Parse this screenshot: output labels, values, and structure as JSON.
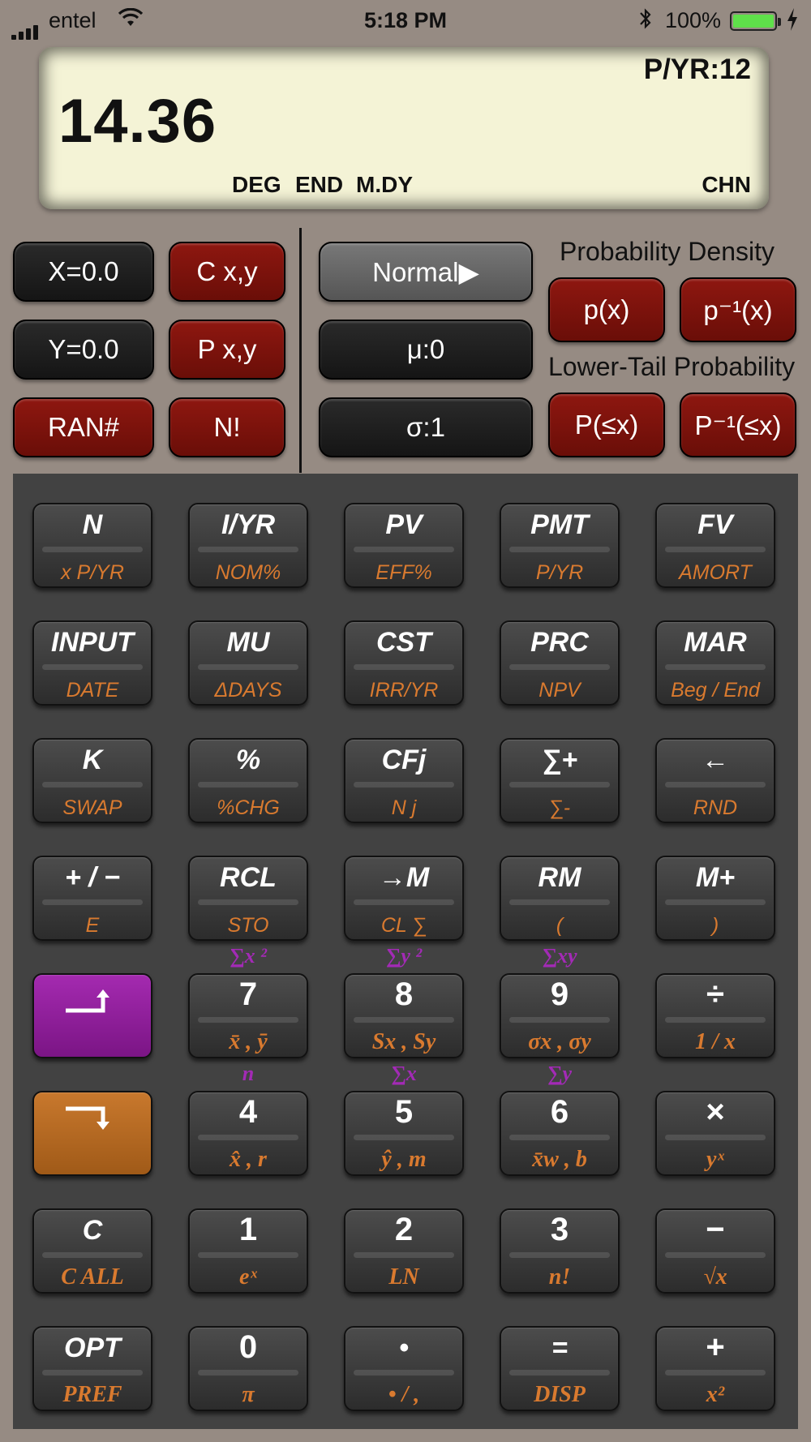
{
  "status_bar": {
    "carrier": "entel",
    "time": "5:18 PM",
    "battery_pct": "100%",
    "battery_color": "#5fe04a"
  },
  "display": {
    "pyr": "P/YR:12",
    "value": "14.36",
    "ind_deg": "DEG",
    "ind_end": "END",
    "ind_mdy": "M.DY",
    "ind_chn": "CHN"
  },
  "stats_panel": {
    "x_label": "X=0.0",
    "y_label": "Y=0.0",
    "ran_label": "RAN#",
    "cxy_label": "C x,y",
    "pxy_label": "P x,y",
    "nfact_label": "N!"
  },
  "dist_panel": {
    "mode_label": "Normal▶",
    "mu_label": "μ:0",
    "sigma_label": "σ:1",
    "density_title": "Probability Density",
    "px_label": "p(x)",
    "pinv_label": "p⁻¹(x)",
    "lower_title": "Lower-Tail Probability",
    "pleq_label": "P(≤x)",
    "pinvleq_label": "P⁻¹(≤x)"
  },
  "keypad": {
    "rows": [
      [
        {
          "main": "N",
          "shift": "x P/YR"
        },
        {
          "main": "I/YR",
          "shift": "NOM%"
        },
        {
          "main": "PV",
          "shift": "EFF%"
        },
        {
          "main": "PMT",
          "shift": "P/YR"
        },
        {
          "main": "FV",
          "shift": "AMORT"
        }
      ],
      [
        {
          "main": "INPUT",
          "shift": "DATE"
        },
        {
          "main": "MU",
          "shift": "ΔDAYS"
        },
        {
          "main": "CST",
          "shift": "IRR/YR"
        },
        {
          "main": "PRC",
          "shift": "NPV"
        },
        {
          "main": "MAR",
          "shift": "Beg / End"
        }
      ],
      [
        {
          "main": "K",
          "shift": "SWAP"
        },
        {
          "main": "%",
          "shift": "%CHG"
        },
        {
          "main": "CFj",
          "shift": "N j"
        },
        {
          "main": "∑+",
          "shift": "∑-"
        },
        {
          "main": "←",
          "shift": "RND"
        }
      ],
      [
        {
          "main": "+ / −",
          "shift": "E"
        },
        {
          "main": "RCL",
          "shift": "STO"
        },
        {
          "main": "→M",
          "shift": "CL ∑"
        },
        {
          "main": "RM",
          "shift": "("
        },
        {
          "main": "M+",
          "shift": ")"
        }
      ],
      [
        {
          "main": "",
          "shift": ""
        },
        {
          "main": "7",
          "shift": "x̄ , ȳ",
          "top": "∑x ²"
        },
        {
          "main": "8",
          "shift": "Sx , Sy",
          "top": "∑y ²"
        },
        {
          "main": "9",
          "shift": "σx , σy",
          "top": "∑xy"
        },
        {
          "main": "÷",
          "shift": "1 / x"
        }
      ],
      [
        {
          "main": "",
          "shift": ""
        },
        {
          "main": "4",
          "shift": "x̂ , r",
          "top": "n"
        },
        {
          "main": "5",
          "shift": "ŷ , m",
          "top": "∑x"
        },
        {
          "main": "6",
          "shift": "x̄w , b",
          "top": "∑y"
        },
        {
          "main": "×",
          "shift": "yˣ"
        }
      ],
      [
        {
          "main": "C",
          "shift": "C ALL"
        },
        {
          "main": "1",
          "shift": "eˣ"
        },
        {
          "main": "2",
          "shift": "LN"
        },
        {
          "main": "3",
          "shift": "n!"
        },
        {
          "main": "−",
          "shift": "√x"
        }
      ],
      [
        {
          "main": "OPT",
          "shift": "PREF"
        },
        {
          "main": "0",
          "shift": "π"
        },
        {
          "main": "•",
          "shift": "• / ,"
        },
        {
          "main": "=",
          "shift": "DISP"
        },
        {
          "main": "+",
          "shift": "x²"
        }
      ]
    ],
    "shift_color": "#d97a2f",
    "blue_shift_color": "#a32ab6"
  }
}
